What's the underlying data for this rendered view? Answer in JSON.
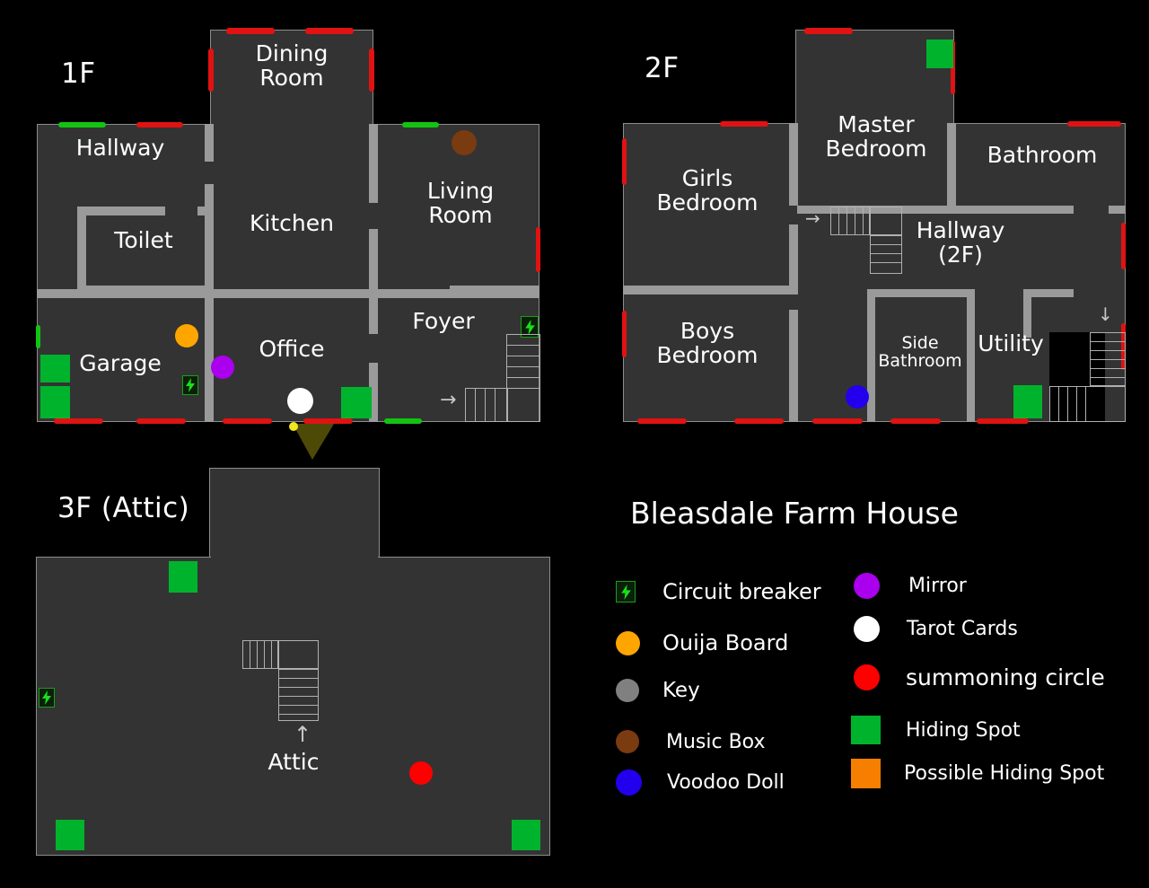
{
  "title": "Bleasdale Farm House",
  "colors": {
    "background": "#000000",
    "room_fill": "#333333",
    "wall": "#9a9a9a",
    "room_outline": "#8c8c8c",
    "door_locked_red": "#e01212",
    "door_open_green": "#12c412",
    "hiding_spot_green": "#00b32d",
    "possible_hiding_orange": "#f77f00",
    "ouija_orange": "#ffa500",
    "mirror_purple": "#aa00ee",
    "tarot_white": "#ffffff",
    "summoning_red": "#ff0000",
    "voodoo_blue": "#2200ee",
    "music_box_brown": "#7a3b10",
    "key_gray": "#808080",
    "breaker_green": "#19e019",
    "text": "#ffffff"
  },
  "floors": [
    {
      "id": "floor-1f",
      "label": "1F",
      "rooms": [
        {
          "name": "Dining\nRoom"
        },
        {
          "name": "Hallway"
        },
        {
          "name": "Toilet"
        },
        {
          "name": "Kitchen"
        },
        {
          "name": "Living\nRoom"
        },
        {
          "name": "Foyer"
        },
        {
          "name": "Garage"
        },
        {
          "name": "Office"
        }
      ],
      "markers": [
        {
          "type": "music-box",
          "room": "Living Room"
        },
        {
          "type": "ouija-board",
          "room": "Garage"
        },
        {
          "type": "mirror",
          "room": "Office"
        },
        {
          "type": "tarot-cards",
          "room": "Office"
        },
        {
          "type": "hiding-spot",
          "room": "Garage"
        },
        {
          "type": "hiding-spot",
          "room": "Garage"
        },
        {
          "type": "hiding-spot",
          "room": "Office"
        },
        {
          "type": "circuit-breaker",
          "room": "Garage"
        },
        {
          "type": "circuit-breaker",
          "room": "Foyer"
        }
      ]
    },
    {
      "id": "floor-2f",
      "label": "2F",
      "rooms": [
        {
          "name": "Master\nBedroom"
        },
        {
          "name": "Girls\nBedroom"
        },
        {
          "name": "Bathroom"
        },
        {
          "name": "Hallway\n(2F)"
        },
        {
          "name": "Boys\nBedroom"
        },
        {
          "name": "Side\nBathroom"
        },
        {
          "name": "Utility"
        }
      ],
      "markers": [
        {
          "type": "hiding-spot",
          "room": "Master Bedroom"
        },
        {
          "type": "hiding-spot",
          "room": "Utility"
        },
        {
          "type": "voodoo-doll",
          "room": "Boys Bedroom"
        }
      ]
    },
    {
      "id": "floor-3f",
      "label": "3F (Attic)",
      "rooms": [
        {
          "name": "Attic"
        }
      ],
      "markers": [
        {
          "type": "hiding-spot",
          "room": "Attic"
        },
        {
          "type": "hiding-spot",
          "room": "Attic"
        },
        {
          "type": "hiding-spot",
          "room": "Attic"
        },
        {
          "type": "summoning-circle",
          "room": "Attic"
        },
        {
          "type": "circuit-breaker",
          "room": "Attic"
        }
      ]
    }
  ],
  "legend": {
    "left_column": [
      {
        "icon": "circuit-breaker-icon",
        "label": "Circuit breaker",
        "color": "#19e019",
        "shape": "breaker"
      },
      {
        "icon": "ouija-board-icon",
        "label": "Ouija Board",
        "color": "#ffa500",
        "shape": "circle"
      },
      {
        "icon": "key-icon",
        "label": "Key",
        "color": "#808080",
        "shape": "circle"
      },
      {
        "icon": "music-box-icon",
        "label": "Music Box",
        "color": "#7a3b10",
        "shape": "circle"
      },
      {
        "icon": "voodoo-doll-icon",
        "label": "Voodoo Doll",
        "color": "#2200ee",
        "shape": "circle"
      }
    ],
    "right_column": [
      {
        "icon": "mirror-icon",
        "label": "Mirror",
        "color": "#aa00ee",
        "shape": "circle"
      },
      {
        "icon": "tarot-cards-icon",
        "label": "Tarot Cards",
        "color": "#ffffff",
        "shape": "circle"
      },
      {
        "icon": "summoning-circle-icon",
        "label": "summoning circle",
        "color": "#ff0000",
        "shape": "circle"
      },
      {
        "icon": "hiding-spot-icon",
        "label": "Hiding Spot",
        "color": "#00b32d",
        "shape": "square"
      },
      {
        "icon": "possible-hiding-icon",
        "label": "Possible Hiding Spot",
        "color": "#f77f00",
        "shape": "square"
      }
    ]
  },
  "stairs": [
    {
      "floor": "1F",
      "label": "",
      "direction": "right"
    },
    {
      "floor": "2F",
      "label": "",
      "direction": "right"
    },
    {
      "floor": "2F",
      "label": "",
      "direction": "down"
    },
    {
      "floor": "3F",
      "label": "Attic",
      "direction": "up"
    }
  ]
}
